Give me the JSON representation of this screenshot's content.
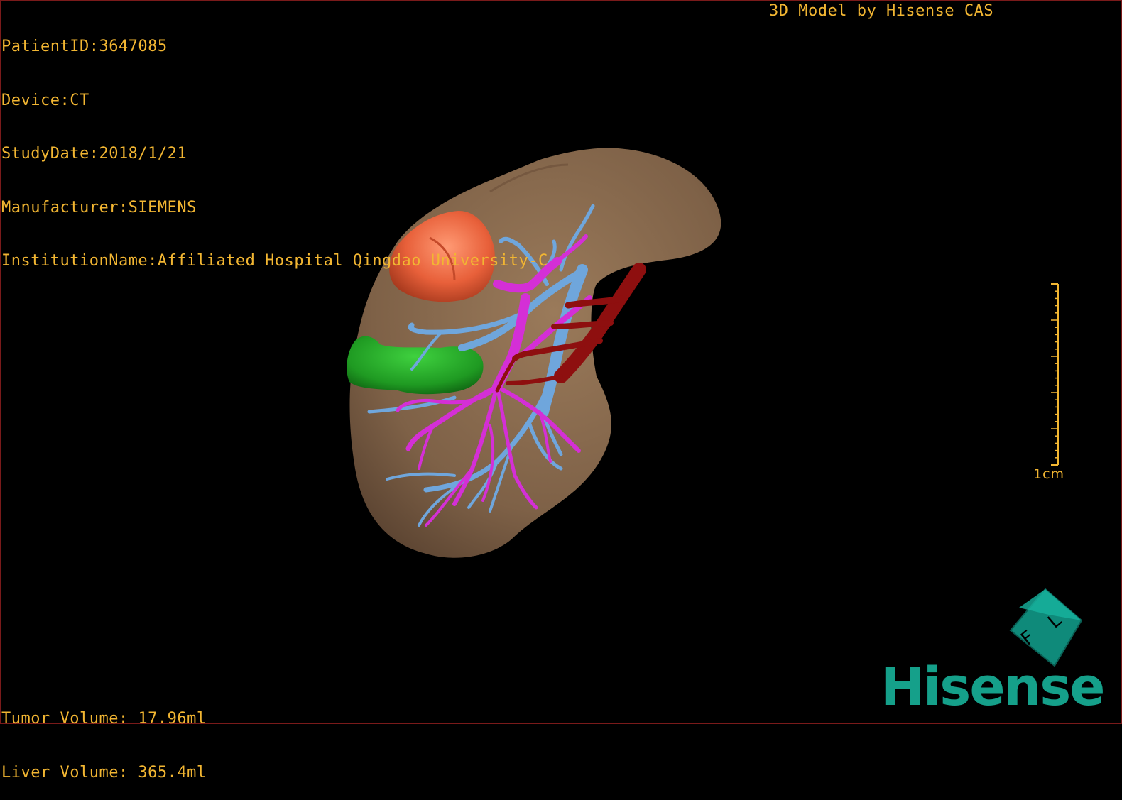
{
  "header": {
    "patient_id": "PatientID:3647085",
    "device": "Device:CT",
    "study_date": "StudyDate:2018/1/21",
    "manufacturer": "Manufacturer:SIEMENS",
    "institution": "InstitutionName:Affiliated Hospital Qingdao University-C"
  },
  "credit": "3D Model by Hisense CAS",
  "volumes": {
    "tumor": "Tumor Volume: 17.96ml",
    "liver": "Liver Volume: 365.4ml"
  },
  "scale": {
    "label": "1cm"
  },
  "orientation_cube": {
    "face_letters": [
      "F",
      "L"
    ]
  },
  "logo": {
    "text": "Hisense"
  },
  "colors": {
    "overlay_text": "#f2b632",
    "liver": "#8a6b4d",
    "tumor": "#e8603a",
    "gallbladder_like": "#1f9a22",
    "portal_vein": "#d42fd6",
    "hepatic_vein": "#6fa6dc",
    "artery": "#8e0f0f",
    "logo": "#15a08a"
  }
}
